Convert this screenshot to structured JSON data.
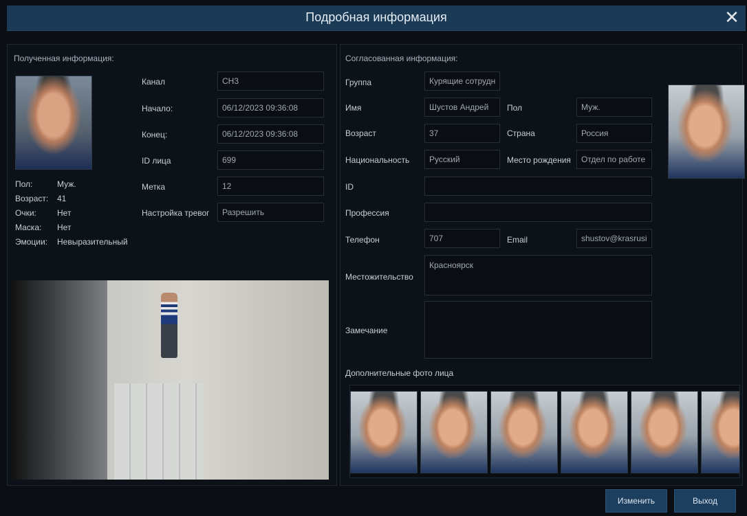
{
  "window": {
    "title": "Подробная информация",
    "close_glyph": "✕"
  },
  "received": {
    "section_title": "Полученная информация:",
    "labels": {
      "channel": "Канал",
      "start": "Начало:",
      "end": "Конец:",
      "face_id": "ID лица",
      "mark": "Метка",
      "alarm": "Настройка тревог"
    },
    "values": {
      "channel": "CH3",
      "start": "06/12/2023 09:36:08",
      "end": "06/12/2023 09:36:08",
      "face_id": "699",
      "mark": "12",
      "alarm": "Разрешить"
    },
    "attributes": [
      {
        "label": "Пол:",
        "value": "Муж."
      },
      {
        "label": "Возраст:",
        "value": "41"
      },
      {
        "label": "Очки:",
        "value": "Нет"
      },
      {
        "label": "Маска:",
        "value": "Нет"
      },
      {
        "label": "Эмоции:",
        "value": "Невыразительный"
      }
    ]
  },
  "matched": {
    "section_title": "Согласованная информация:",
    "labels": {
      "group": "Группа",
      "name": "Имя",
      "gender": "Пол",
      "age": "Возраст",
      "country": "Страна",
      "nationality": "Национальность",
      "birthplace": "Место рождения",
      "id": "ID",
      "profession": "Профессия",
      "phone": "Телефон",
      "email": "Email",
      "residence": "Местожительство",
      "remark": "Замечание"
    },
    "values": {
      "group": "Курящие сотрудн",
      "name": "Шустов Андрей",
      "gender": "Муж.",
      "age": "37",
      "country": "Россия",
      "nationality": "Русский",
      "birthplace": "Отдел по работе",
      "id": "",
      "profession": "",
      "phone": "707",
      "email": "shustov@krasrusi",
      "residence": "Красноярск",
      "remark": ""
    },
    "extra_photos_title": "Дополнительные фото лица"
  },
  "buttons": {
    "edit": "Изменить",
    "exit": "Выход"
  }
}
